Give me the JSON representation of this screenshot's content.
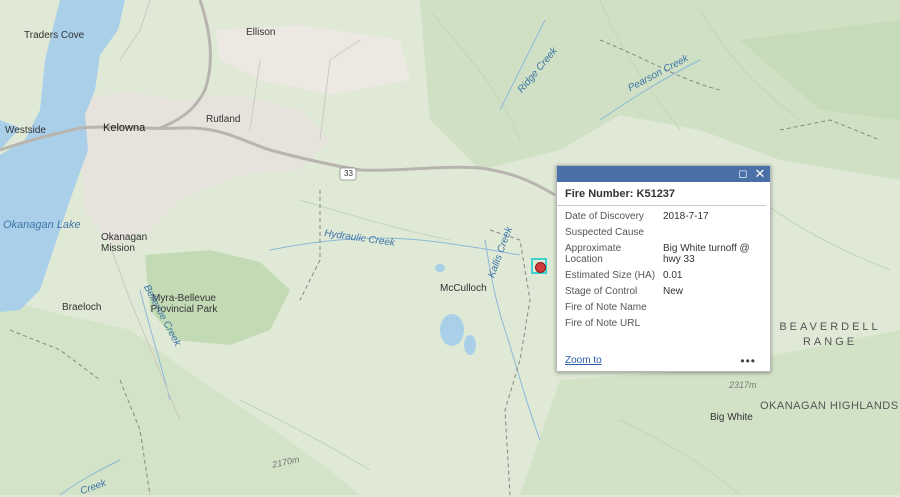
{
  "places": {
    "traders_cove": "Traders Cove",
    "ellison": "Ellison",
    "westside": "Westside",
    "kelowna": "Kelowna",
    "rutland": "Rutland",
    "okanagan_lake": "Okanagan Lake",
    "okanagan_mission": "Okanagan Mission",
    "myra_bellevue": "Myra-Bellevue Provincial Park",
    "braeloch": "Braeloch",
    "mcculloch": "McCulloch",
    "big_white": "Big White",
    "beaverdell_range": "BEAVERDELL RANGE",
    "okanagan_highlands": "OKANAGAN HIGHLANDS",
    "hydraulic_creek": "Hydraulic Creek",
    "ridge_creek": "Ridge Creek",
    "pearson_creek": "Pearson Creek",
    "kallis_creek": "Kallis Creek",
    "bellevue_creek": "Bellevue Creek",
    "lower_creek": "Creek"
  },
  "elevations": {
    "e2317": "2317m",
    "e2170": "2170m"
  },
  "highway_shield": "33",
  "popup": {
    "title": "Fire Number: K51237",
    "fields": [
      {
        "key": "Date of Discovery",
        "value": "2018-7-17"
      },
      {
        "key": "Suspected Cause",
        "value": ""
      },
      {
        "key": "Approximate Location",
        "value": "Big White turnoff @ hwy 33"
      },
      {
        "key": "Estimated Size (HA)",
        "value": "0.01"
      },
      {
        "key": "Stage of Control",
        "value": "New"
      },
      {
        "key": "Fire of Note Name",
        "value": ""
      },
      {
        "key": "Fire of Note URL",
        "value": ""
      }
    ],
    "zoom_label": "Zoom to",
    "more_label": "•••",
    "maximize_icon": "maximize-icon",
    "close_icon": "close-icon"
  },
  "colors": {
    "water": "#a9cfe9",
    "land": "#dfe9d6",
    "urban": "#e6e2dc",
    "popup_bar": "#4a70a8",
    "fire_marker": "#d23a3a",
    "selection": "#3fd0d0"
  }
}
